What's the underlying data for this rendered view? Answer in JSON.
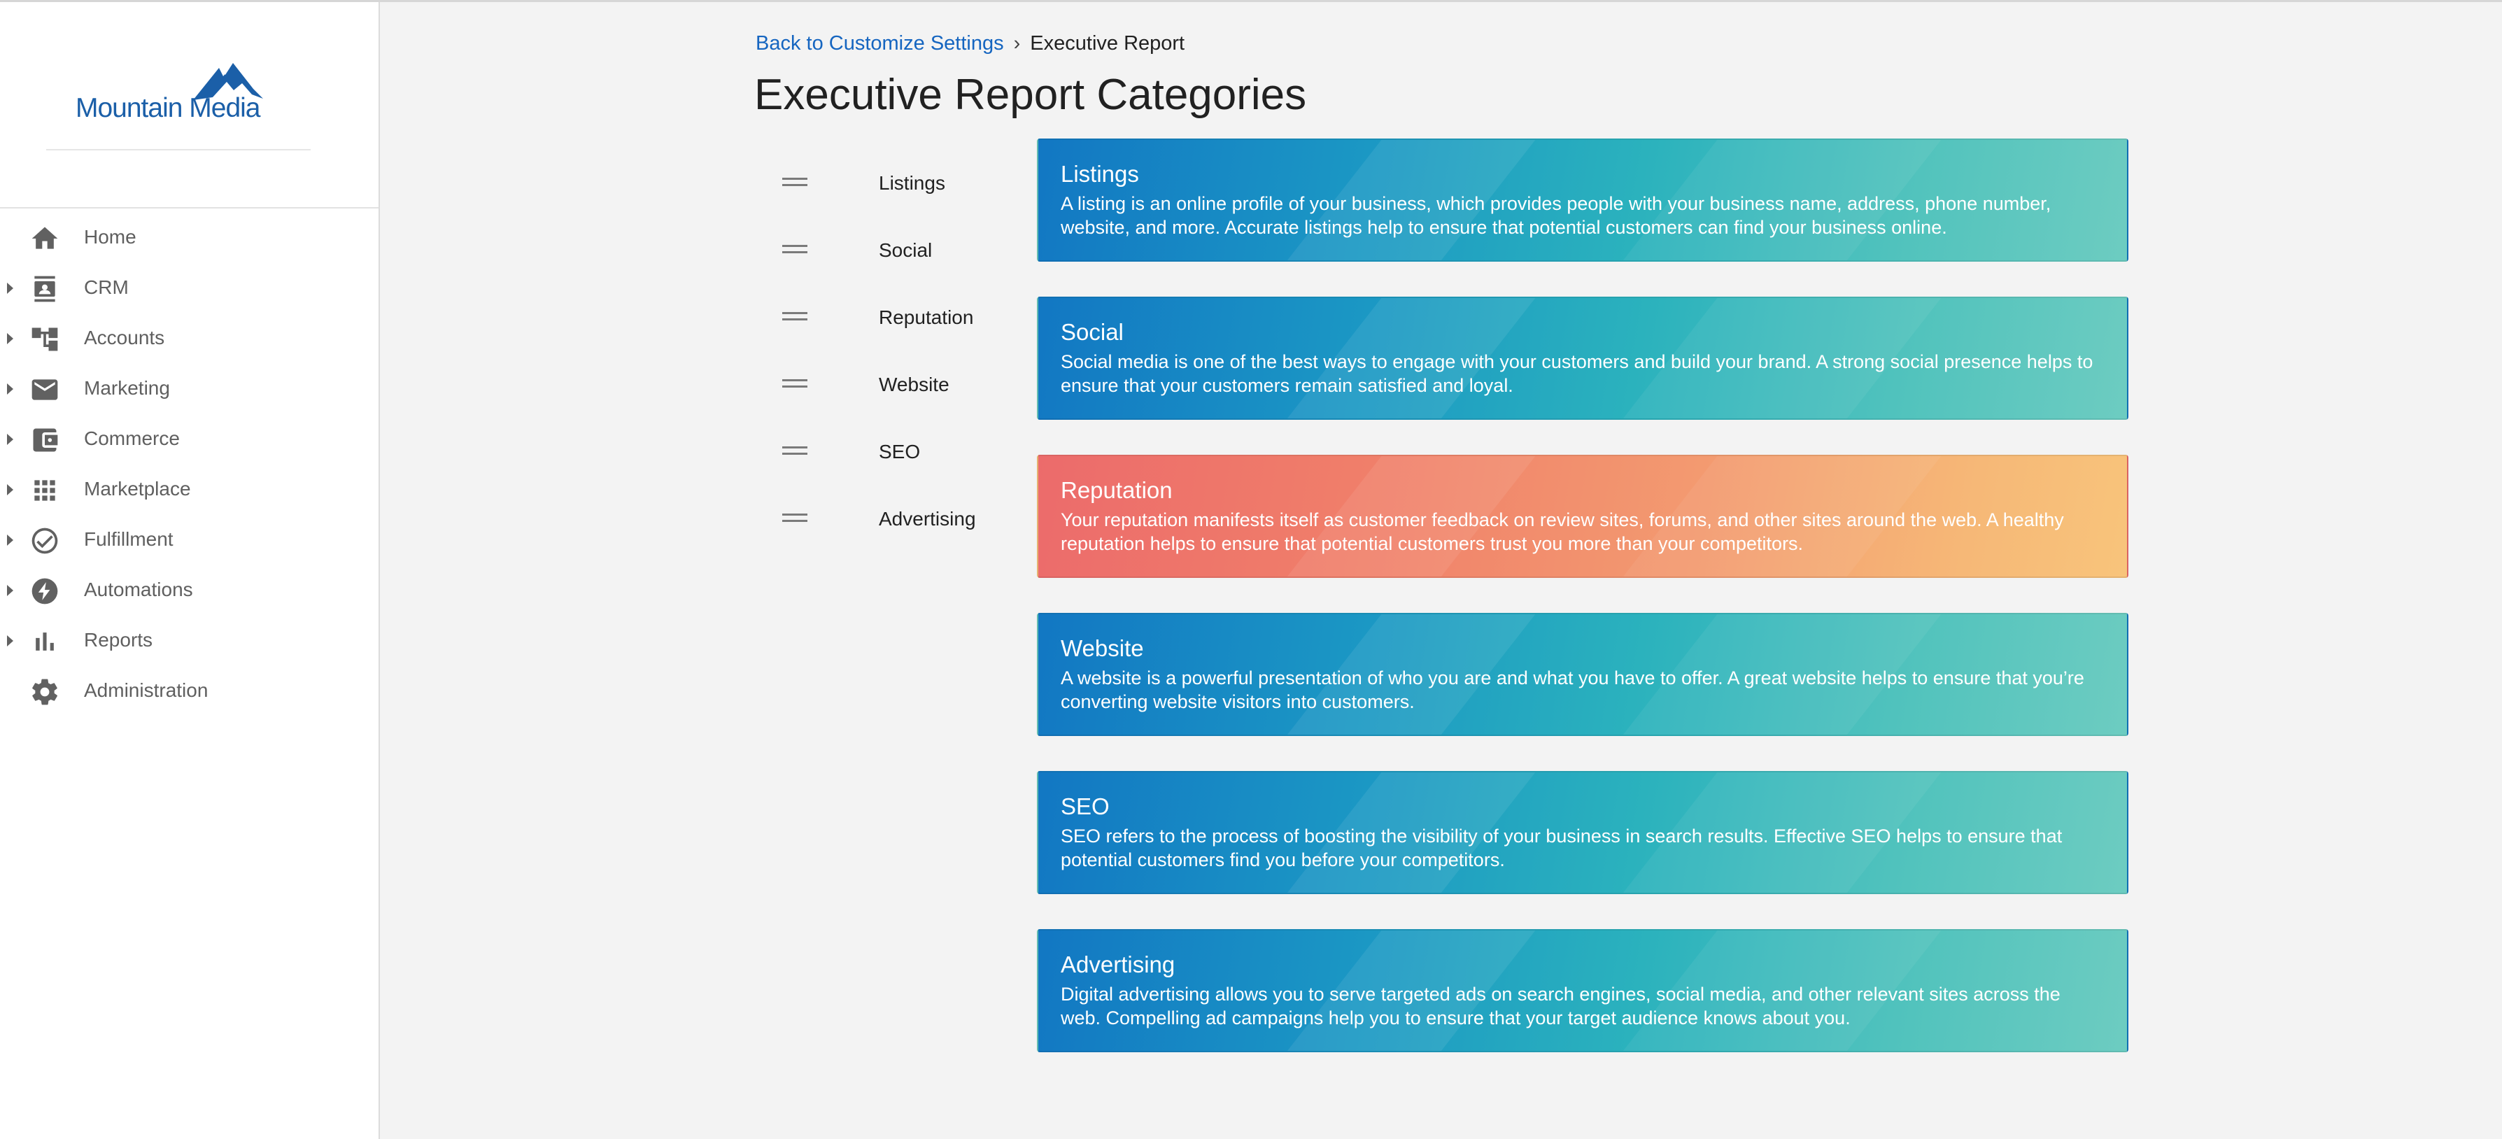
{
  "brand": {
    "name": "Mountain Media",
    "color": "#1b5fa8"
  },
  "sidebar": {
    "items": [
      {
        "label": "Home",
        "icon": "home-icon",
        "expandable": false
      },
      {
        "label": "CRM",
        "icon": "contact-card-icon",
        "expandable": true
      },
      {
        "label": "Accounts",
        "icon": "hierarchy-icon",
        "expandable": true
      },
      {
        "label": "Marketing",
        "icon": "mail-icon",
        "expandable": true
      },
      {
        "label": "Commerce",
        "icon": "wallet-icon",
        "expandable": true
      },
      {
        "label": "Marketplace",
        "icon": "grid-icon",
        "expandable": true
      },
      {
        "label": "Fulfillment",
        "icon": "check-circle-icon",
        "expandable": true
      },
      {
        "label": "Automations",
        "icon": "bolt-icon",
        "expandable": true
      },
      {
        "label": "Reports",
        "icon": "bar-chart-icon",
        "expandable": true
      },
      {
        "label": "Administration",
        "icon": "gear-icon",
        "expandable": false
      }
    ]
  },
  "breadcrumb": {
    "back_label": "Back to Customize Settings",
    "separator": "›",
    "current": "Executive Report"
  },
  "page": {
    "title": "Executive Report Categories"
  },
  "categories": [
    {
      "name": "Listings",
      "title": "Listings",
      "description": "A listing is an online profile of your business, which provides people with your business name, address, phone number, website, and more. Accurate listings help to ensure that potential customers can find your business online.",
      "theme": "cool"
    },
    {
      "name": "Social",
      "title": "Social",
      "description": "Social media is one of the best ways to engage with your customers and build your brand. A strong social presence helps to ensure that your customers remain satisfied and loyal.",
      "theme": "cool"
    },
    {
      "name": "Reputation",
      "title": "Reputation",
      "description": "Your reputation manifests itself as customer feedback on review sites, forums, and other sites around the web. A healthy reputation helps to ensure that potential customers trust you more than your competitors.",
      "theme": "warm"
    },
    {
      "name": "Website",
      "title": "Website",
      "description": "A website is a powerful presentation of who you are and what you have to offer. A great website helps to ensure that you’re converting website visitors into customers.",
      "theme": "cool"
    },
    {
      "name": "SEO",
      "title": "SEO",
      "description": "SEO refers to the process of boosting the visibility of your business in search results. Effective SEO helps to ensure that potential customers find you before your competitors.",
      "theme": "cool"
    },
    {
      "name": "Advertising",
      "title": "Advertising",
      "description": "Digital advertising allows you to serve targeted ads on search engines, social media, and other relevant sites across the web. Compelling ad campaigns help you to ensure that your target audience knows about you.",
      "theme": "cool"
    }
  ],
  "colors": {
    "link": "#1565c0",
    "cool_gradient": [
      "#1277c3",
      "#6dccc1"
    ],
    "warm_gradient": [
      "#ec6b6b",
      "#f8c47b"
    ],
    "sidebar_text": "#5f5f5f"
  }
}
